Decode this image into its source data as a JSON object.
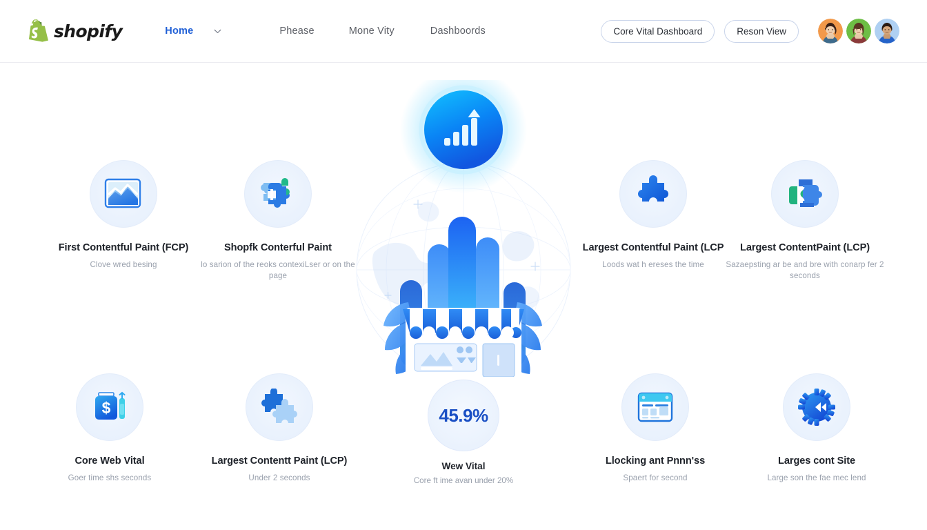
{
  "brand": {
    "name": "shopify",
    "logo_icon": "shopify-bag-icon",
    "logo_color": "#8CB843"
  },
  "topbar": {
    "nav": [
      {
        "label": "Home",
        "active": true,
        "icon": "chevron-down-icon"
      },
      {
        "label": "Phease",
        "active": false
      },
      {
        "label": "Mone Vity",
        "active": false
      },
      {
        "label": "Dashboords",
        "active": false
      }
    ],
    "buttons": [
      {
        "label": "Core Vital Dashboard",
        "name": "core-vital-dashboard-button"
      },
      {
        "label": "Reson View",
        "name": "reson-view-button"
      }
    ],
    "avatars": [
      {
        "name": "avatar-1",
        "bg": "#F2994A"
      },
      {
        "name": "avatar-2",
        "bg": "#6DBE45"
      },
      {
        "name": "avatar-3",
        "bg": "#5B9BE8"
      }
    ]
  },
  "hero": {
    "badge_icon": "bar-chart-signal-icon",
    "illustration": "globe-storefront-bars-illustration",
    "accent": "#0B7BF5"
  },
  "cards": [
    {
      "name": "card-first-contentful-paint",
      "icon": "image-chart-icon",
      "title": "First Contentful Paint (FCP)",
      "subtitle": "Clove wred besing"
    },
    {
      "name": "card-shopfk-contentful-paint",
      "icon": "puzzle-two-piece-icon",
      "title": "Shopfk Conterful Paint",
      "subtitle": "lo sarion of the reoks contexiLser or on the page"
    },
    {
      "name": "card-largest-contentful-paint-lcp",
      "icon": "puzzle-single-piece-icon",
      "title": "Largest Contentful Paint (LCP",
      "subtitle": "Loods wat h ereses the time"
    },
    {
      "name": "card-largest-contentpaint-lcp",
      "icon": "puzzle-green-blue-icon",
      "title": "Largest ContentPaint (LCP)",
      "subtitle": "Sazaepsting ar be and bre with conarp fer 2 seconds"
    },
    {
      "name": "card-core-web-vital",
      "icon": "money-bag-icon",
      "title": "Core Web Vital",
      "subtitle": "Goer time shs seconds"
    },
    {
      "name": "card-largest-contentt-paint-lcp",
      "icon": "puzzle-pair-icon",
      "title": "Largest Contentt Paint (LCP)",
      "subtitle": "Under 2 seconds"
    },
    {
      "name": "card-llocking-ant-process",
      "icon": "browser-window-icon",
      "title": "Llocking ant Pnnn'ss",
      "subtitle": "Spaert for second"
    },
    {
      "name": "card-larges-cont-site",
      "icon": "gear-rewind-icon",
      "title": "Larges cont Site",
      "subtitle": "Large son the fae mec lend"
    }
  ],
  "stat": {
    "name": "core-web-vital-score",
    "value": "45.9%",
    "title": "Wew Vital",
    "subtitle": "Core ft ime avan under 20%"
  }
}
